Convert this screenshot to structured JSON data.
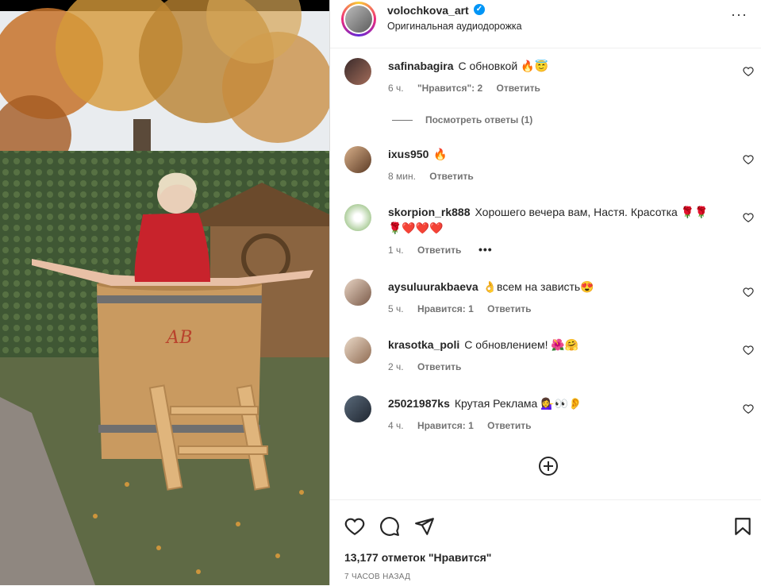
{
  "post": {
    "username": "volochkova_art",
    "subtitle": "Оригинальная аудиодорожка",
    "likes_text": "13,177 отметок \"Нравится\"",
    "time_text": "7 ЧАСОВ НАЗАД",
    "verified_mark": "✓",
    "more_label": "···"
  },
  "media": {
    "barrel_monogram": "АВ"
  },
  "view_replies_label": "Посмотреть ответы (1)",
  "comments": [
    {
      "user": "safinabagira",
      "text": "С обновкой 🔥😇",
      "time": "6 ч.",
      "likes": "\"Нравится\": 2",
      "reply": "Ответить"
    },
    {
      "user": "ixus950",
      "text": "🔥",
      "time": "8 мин.",
      "likes": "",
      "reply": "Ответить"
    },
    {
      "user": "skorpion_rk888",
      "text": "Хорошего вечера вам, Настя. Красотка 🌹🌹🌹❤️❤️❤️",
      "time": "1 ч.",
      "likes": "",
      "reply": "Ответить",
      "dots": "•••"
    },
    {
      "user": "aysuluurakbaeva",
      "text": "👌всем на зависть😍",
      "time": "5 ч.",
      "likes": "Нравится: 1",
      "reply": "Ответить"
    },
    {
      "user": "krasotka_poli",
      "text": "С обновлением! 🌺🤗",
      "time": "2 ч.",
      "likes": "",
      "reply": "Ответить"
    },
    {
      "user": "25021987ks",
      "text": "Крутая Реклама 💁‍♀️👀👂",
      "time": "4 ч.",
      "likes": "Нравится: 1",
      "reply": "Ответить"
    }
  ],
  "colors": {
    "accent_blue": "#0095f6",
    "text_primary": "#262626",
    "text_secondary": "#737373"
  }
}
